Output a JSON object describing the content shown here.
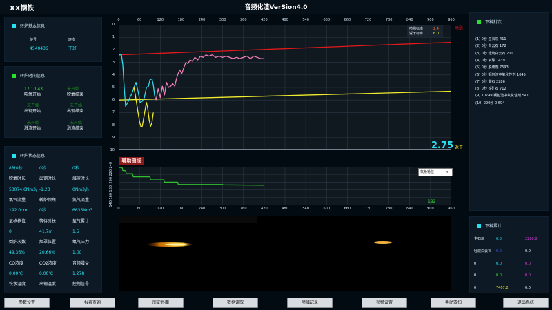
{
  "app": {
    "company": "XX钢铁",
    "title": "音频化渣VerSion4.0"
  },
  "basic_info": {
    "title": "转炉基本信息",
    "furnace_label": "炉号",
    "furnace_value": "4540436",
    "shift_label": "班次",
    "shift_value": "丁班"
  },
  "time_info": {
    "title": "转炉时间信息",
    "items": [
      {
        "status": "17:10:43",
        "label": "吹氧开始"
      },
      {
        "status": "未开始",
        "label": "吹氧结束"
      },
      {
        "status": "未开始",
        "label": "出钢开始"
      },
      {
        "status": "未开始",
        "label": "出钢结束"
      },
      {
        "status": "未开始",
        "label": "溅渣开始"
      },
      {
        "status": "未开始",
        "label": "溅渣结束"
      }
    ]
  },
  "status_info": {
    "title": "转炉状态信息",
    "rows": [
      [
        {
          "v": "8分0秒",
          "c": "cy"
        },
        {
          "v": "0秒",
          "c": "cy"
        },
        {
          "v": "0秒",
          "c": "cy"
        }
      ],
      [
        {
          "v": "吹氧时长",
          "c": "wh"
        },
        {
          "v": "出钢时长",
          "c": "wh"
        },
        {
          "v": "溅渣时长",
          "c": "wh"
        }
      ],
      [
        {
          "v": "53074.6Nm3/",
          "c": "cy"
        },
        {
          "v": "-1.23",
          "c": "cy"
        },
        {
          "v": "0Nm3/h",
          "c": "cy"
        }
      ],
      [
        {
          "v": "氧气流量",
          "c": "wh"
        },
        {
          "v": "转炉倾角",
          "c": "wh"
        },
        {
          "v": "氮气流量",
          "c": "wh"
        }
      ],
      [
        {
          "v": "192.0cm",
          "c": "cy"
        },
        {
          "v": "0秒",
          "c": "cy"
        },
        {
          "v": "6633Nm3",
          "c": "cy"
        }
      ],
      [
        {
          "v": "氧枪枪位",
          "c": "wh"
        },
        {
          "v": "等待时长",
          "c": "wh"
        },
        {
          "v": "氧气累计",
          "c": "wh"
        }
      ],
      [
        {
          "v": "0",
          "c": "cy"
        },
        {
          "v": "41.7m",
          "c": "cy"
        },
        {
          "v": "1.5",
          "c": "cy"
        }
      ],
      [
        {
          "v": "倒炉次数",
          "c": "wh"
        },
        {
          "v": "烟罩位置",
          "c": "wh"
        },
        {
          "v": "氧气压力",
          "c": "wh"
        }
      ],
      [
        {
          "v": "49.36%",
          "c": "cy"
        },
        {
          "v": "20.66%",
          "c": "cy"
        },
        {
          "v": "1.00",
          "c": "cy"
        }
      ],
      [
        {
          "v": "CO浓度",
          "c": "wh"
        },
        {
          "v": "CO2浓度",
          "c": "wh"
        },
        {
          "v": "音频增益",
          "c": "wh"
        }
      ],
      [
        {
          "v": "0.00℃",
          "c": "cy"
        },
        {
          "v": "0.00℃",
          "c": "cy"
        },
        {
          "v": "1.278",
          "c": "cy"
        }
      ],
      [
        {
          "v": "铁水温度",
          "c": "wh"
        },
        {
          "v": "出钢温度",
          "c": "wh"
        },
        {
          "v": "控制信号",
          "c": "wh"
        }
      ]
    ]
  },
  "main_chart": {
    "legend_upper_label": "喷溅标准",
    "legend_upper_value": "2.4",
    "legend_lower_label": "返干标准",
    "legend_lower_value": "6.0",
    "label_top_right": "喷溅",
    "label_bottom_right": "返干",
    "current_value": "2.75"
  },
  "aux_chart": {
    "title": "辅助曲线",
    "select_value": "氧枪枪位",
    "select_arrow": "▾",
    "readout": "192"
  },
  "batch": {
    "title": "下料批次",
    "items": [
      "(1) 0秒 生石灰 411",
      "(2) 0秒 白云石 172",
      "(3) 0秒 轻烧白云石 201",
      "(4) 0秒 氧球 1439",
      "(5) 0秒 脱硫剂 7593",
      "(6) 0秒 钢包渣中氧化性剂 1045",
      "(7) 0秒 萤石 2286",
      "(8) 0秒 铁矿石 712",
      "(9) 10749 钢包渣中氧化性剂 541",
      "(10) 290秒 0 694"
    ]
  },
  "cumulative": {
    "title": "下料累计",
    "rows": [
      [
        {
          "v": "生石灰",
          "c": "wh"
        },
        {
          "v": "0.0",
          "c": "cy"
        },
        {
          "v": "",
          "c": "wh"
        },
        {
          "v": "2280.0",
          "c": "mg"
        }
      ],
      [
        {
          "v": "轻烧白云石",
          "c": "wh"
        },
        {
          "v": "0.0",
          "c": "bl"
        },
        {
          "v": "",
          "c": "wh"
        },
        {
          "v": "0.0",
          "c": "wh"
        }
      ],
      [
        {
          "v": "0",
          "c": "wh"
        },
        {
          "v": "0.0",
          "c": "cy"
        },
        {
          "v": "",
          "c": "wh"
        },
        {
          "v": "0.0",
          "c": "mg"
        }
      ],
      [
        {
          "v": "0",
          "c": "wh"
        },
        {
          "v": "0.0",
          "c": "gr"
        },
        {
          "v": "",
          "c": "wh"
        },
        {
          "v": "0.0",
          "c": "mg"
        }
      ],
      [
        {
          "v": "0",
          "c": "wh"
        },
        {
          "v": "7407.2",
          "c": "yl"
        },
        {
          "v": "",
          "c": "wh"
        },
        {
          "v": "0.0",
          "c": "wh"
        }
      ]
    ]
  },
  "buttons": [
    "参数设置",
    "报表查询",
    "历史界面",
    "数据读取",
    "喷溅记录",
    "视频设置",
    "手动双扫",
    "退出系统"
  ],
  "colors": {
    "accent": "#29e0f0",
    "red_line": "#e01a1a",
    "yellow_line": "#f0ec2e",
    "pink_line": "#f27fb9",
    "cyan_line": "#33d8ec",
    "green_line": "#2fbf2f"
  },
  "chart_data": [
    {
      "type": "line",
      "x_ticks": [
        0,
        60,
        120,
        180,
        240,
        300,
        360,
        420,
        480,
        540,
        600,
        660,
        720,
        780,
        840,
        900,
        960
      ],
      "y_ticks": [
        0,
        1,
        2,
        3,
        4,
        5,
        6,
        7,
        8,
        9,
        10
      ],
      "xlim": [
        0,
        960
      ],
      "ylim": [
        10,
        0
      ],
      "series": [
        {
          "name": "喷溅标准",
          "color": "#e01a1a",
          "points": [
            [
              0,
              2.4
            ],
            [
              960,
              1.4
            ]
          ]
        },
        {
          "name": "返干标准",
          "color": "#f0ec2e",
          "points": [
            [
              0,
              6.0
            ],
            [
              960,
              5.3
            ]
          ]
        },
        {
          "color": "#33d8ec",
          "points": [
            [
              0,
              2.4
            ],
            [
              8,
              2.4
            ],
            [
              12,
              3.2
            ],
            [
              16,
              5.0
            ],
            [
              20,
              6.5
            ],
            [
              26,
              6.2
            ],
            [
              32,
              5.8
            ],
            [
              38,
              5.5
            ],
            [
              44,
              5.0
            ],
            [
              50,
              4.6
            ],
            [
              56,
              5.3
            ],
            [
              62,
              6.2
            ],
            [
              68,
              6.1
            ],
            [
              74,
              5.8
            ],
            [
              80,
              5.0
            ],
            [
              86,
              4.9
            ],
            [
              90,
              4.4
            ],
            [
              96,
              4.3
            ],
            [
              100,
              4.8
            ],
            [
              104,
              5.7
            ],
            [
              108,
              6.0
            ]
          ]
        },
        {
          "color": "#f0ec2e",
          "points": [
            [
              44,
              5.0
            ],
            [
              48,
              5.6
            ],
            [
              52,
              6.3
            ],
            [
              56,
              7.0
            ],
            [
              60,
              7.7
            ],
            [
              64,
              8.1
            ],
            [
              68,
              8.1
            ],
            [
              72,
              7.5
            ],
            [
              76,
              6.8
            ],
            [
              80,
              6.2
            ],
            [
              84,
              6.7
            ],
            [
              88,
              7.6
            ],
            [
              92,
              8.1
            ],
            [
              96,
              7.8
            ],
            [
              100,
              7.0
            ]
          ]
        },
        {
          "color": "#f27fb9",
          "points": [
            [
              108,
              6.0
            ],
            [
              114,
              5.1
            ],
            [
              120,
              5.8
            ],
            [
              126,
              4.9
            ],
            [
              132,
              5.6
            ],
            [
              138,
              4.6
            ],
            [
              144,
              5.0
            ],
            [
              150,
              4.9
            ],
            [
              156,
              4.7
            ],
            [
              162,
              4.9
            ],
            [
              166,
              4.4
            ],
            [
              170,
              4.0
            ],
            [
              176,
              3.6
            ],
            [
              182,
              3.9
            ],
            [
              188,
              3.4
            ],
            [
              194,
              3.0
            ],
            [
              200,
              3.1
            ],
            [
              206,
              2.8
            ],
            [
              212,
              2.9
            ],
            [
              220,
              2.6
            ],
            [
              228,
              2.8
            ],
            [
              236,
              2.5
            ],
            [
              244,
              2.6
            ],
            [
              252,
              2.4
            ],
            [
              260,
              2.5
            ],
            [
              270,
              2.4
            ],
            [
              280,
              2.6
            ],
            [
              290,
              2.5
            ],
            [
              300,
              2.6
            ],
            [
              310,
              2.5
            ],
            [
              320,
              2.6
            ],
            [
              330,
              2.7
            ],
            [
              340,
              2.6
            ],
            [
              350,
              2.7
            ],
            [
              360,
              2.6
            ],
            [
              370,
              2.5
            ],
            [
              380,
              2.7
            ],
            [
              390,
              2.5
            ],
            [
              400,
              2.6
            ],
            [
              410,
              2.7
            ],
            [
              420,
              2.7
            ]
          ]
        }
      ]
    },
    {
      "type": "line",
      "x_ticks": [
        0,
        60,
        120,
        180,
        240,
        300,
        360,
        420,
        480,
        540,
        600,
        660,
        720,
        780,
        840,
        900,
        960
      ],
      "y_ticks": [
        140,
        160,
        180,
        200,
        220,
        240
      ],
      "xlim": [
        0,
        960
      ],
      "ylim": [
        140,
        240
      ],
      "series": [
        {
          "name": "氧枪枪位",
          "color": "#2fbf2f",
          "points": [
            [
              0,
              238
            ],
            [
              10,
              238
            ],
            [
              12,
              230
            ],
            [
              20,
              230
            ],
            [
              22,
              222
            ],
            [
              40,
              222
            ],
            [
              42,
              214
            ],
            [
              90,
              214
            ],
            [
              92,
              206
            ],
            [
              130,
              206
            ],
            [
              132,
              200
            ],
            [
              170,
              200
            ],
            [
              172,
              194
            ],
            [
              300,
              194
            ],
            [
              302,
              193
            ],
            [
              420,
              192
            ]
          ]
        }
      ]
    }
  ]
}
